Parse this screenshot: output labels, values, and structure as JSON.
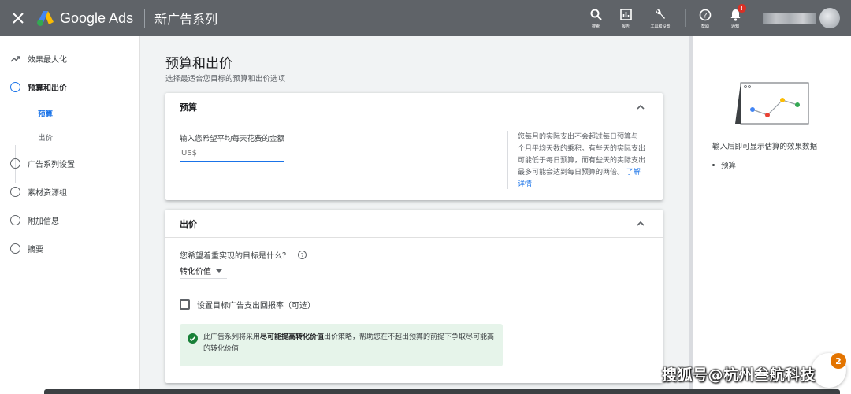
{
  "topbar": {
    "brand": "Google Ads",
    "title": "新广告系列",
    "actions": [
      {
        "icon": "search-icon",
        "label": "搜索"
      },
      {
        "icon": "reports-icon",
        "label": "报告"
      },
      {
        "icon": "wrench-icon",
        "label": "工具和设置"
      },
      {
        "icon": "help-icon",
        "label": "帮助"
      },
      {
        "icon": "bell-icon",
        "label": "通知",
        "badge": "!"
      }
    ]
  },
  "nav": {
    "items": [
      {
        "label": "效果最大化"
      },
      {
        "label": "预算和出价"
      },
      {
        "label": "广告系列设置"
      },
      {
        "label": "素材资源组"
      },
      {
        "label": "附加信息"
      },
      {
        "label": "摘要"
      }
    ],
    "sub": [
      {
        "label": "预算"
      },
      {
        "label": "出价"
      }
    ]
  },
  "main": {
    "title": "预算和出价",
    "subtitle": "选择最适合您目标的预算和出价选项",
    "budget": {
      "heading": "预算",
      "input_label": "输入您希望平均每天花费的金额",
      "input_placeholder": "US$",
      "help_text": "您每月的实际支出不会超过每日预算与一个月平均天数的乘积。有些天的实际支出可能低于每日预算，而有些天的实际支出最多可能会达到每日预算的两倍。",
      "help_link": "了解详情"
    },
    "bidding": {
      "heading": "出价",
      "question": "您希望着重实现的目标是什么？",
      "selected_value": "转化价值",
      "checkbox_label": "设置目标广告支出回报率（可选）",
      "note_prefix": "此广告系列将采用",
      "note_bold": "尽可能提高转化价值",
      "note_suffix": "出价策略，帮助您在不超出预算的前提下争取尽可能高的转化价值"
    }
  },
  "right_panel": {
    "text": "输入后即可显示估算的效果数据",
    "bullet": "预算"
  },
  "watermark": "搜狐号@杭州叁航科技",
  "fab_badge": "2",
  "colors": {
    "topbar": "#5f6368",
    "accent": "#1a73e8",
    "success_bg": "#e6f4ea",
    "success": "#188038"
  }
}
